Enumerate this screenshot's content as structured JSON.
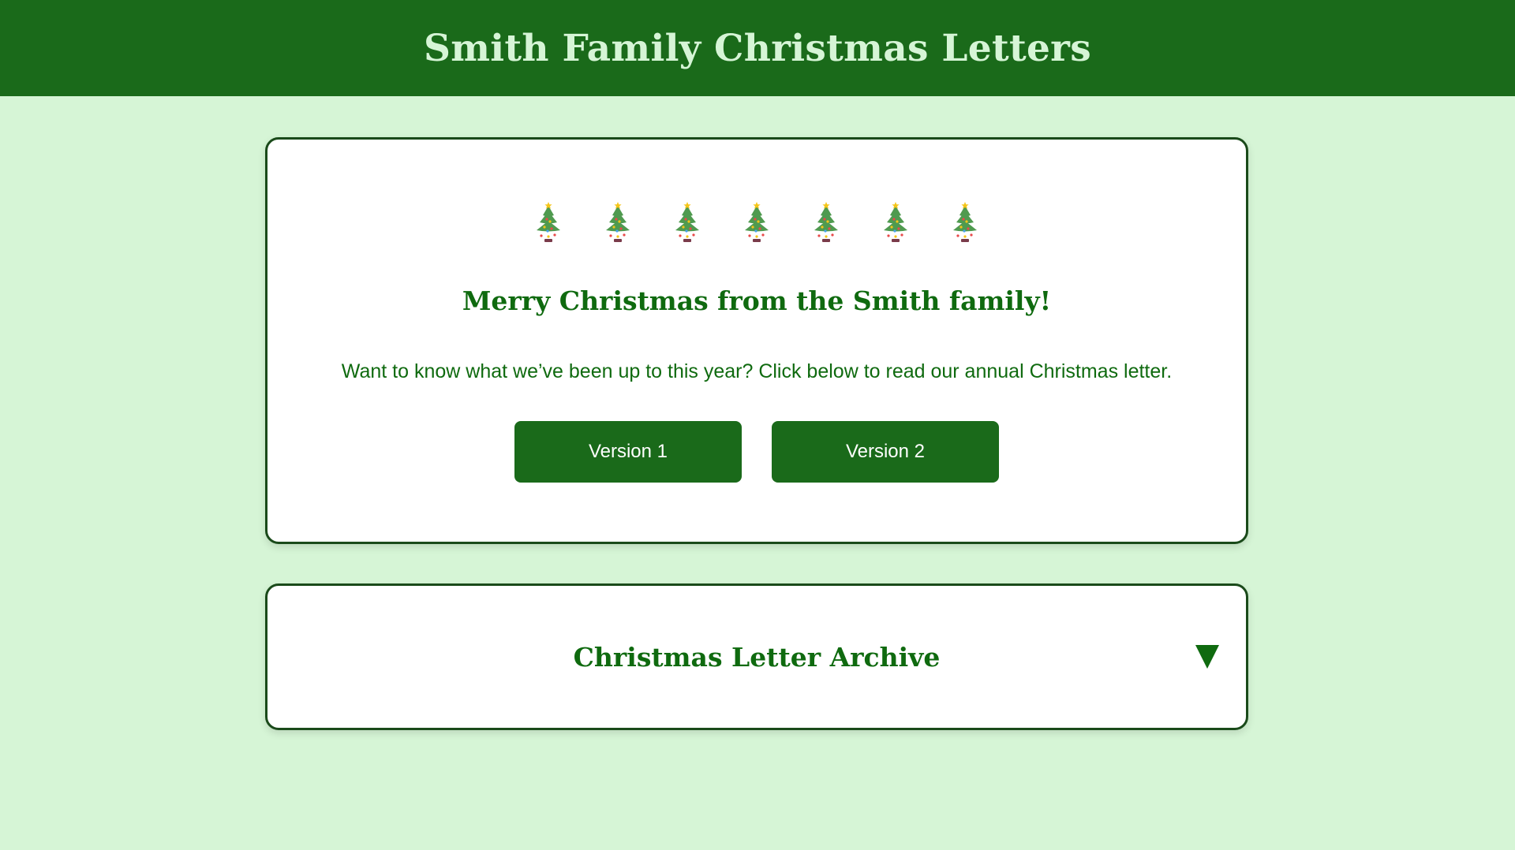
{
  "header": {
    "title": "Smith Family Christmas Letters"
  },
  "welcome": {
    "tree_icon_count": 7,
    "tree_icon": "christmas-tree-icon",
    "greeting": "Merry Christmas from the Smith family!",
    "intro": "Want to know what we’ve been up to this year? Click below to read our annual Christmas letter.",
    "buttons": [
      {
        "label": "Version 1"
      },
      {
        "label": "Version 2"
      }
    ]
  },
  "archive": {
    "title": "Christmas Letter Archive",
    "toggle_icon": "triangle-down-icon"
  },
  "colors": {
    "header_bg": "#1a6a1a",
    "page_bg": "#d6f5d6",
    "accent": "#0f6a0f"
  }
}
